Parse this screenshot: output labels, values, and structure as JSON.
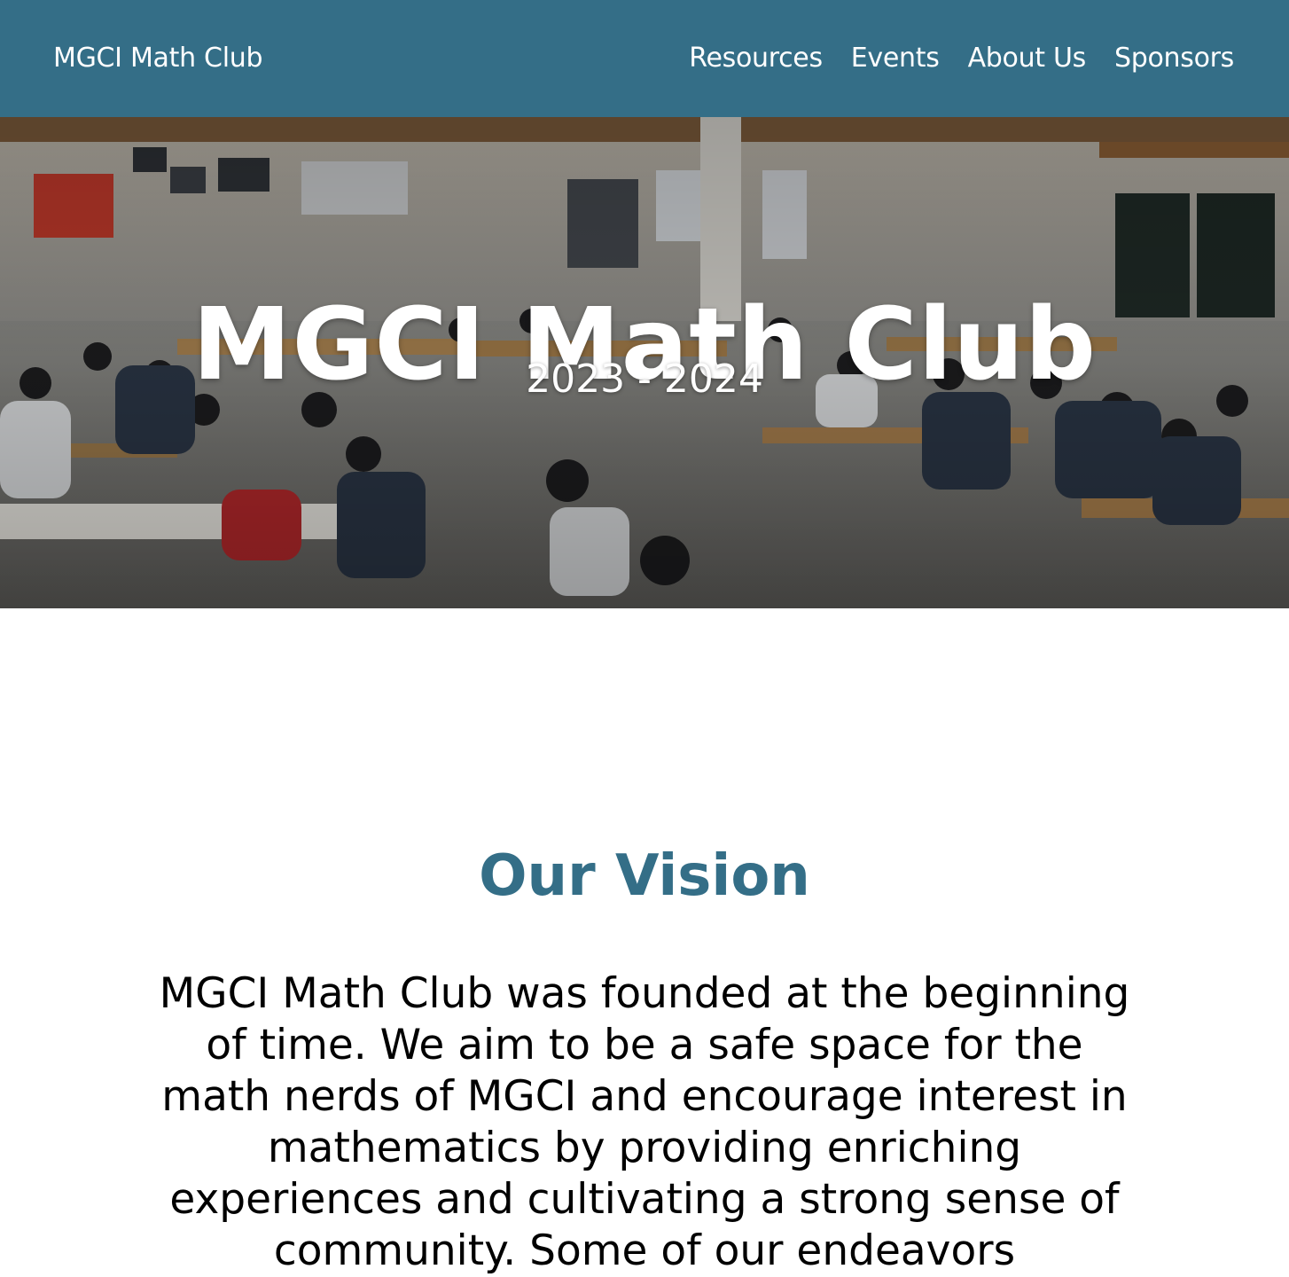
{
  "navbar": {
    "brand": "MGCI Math Club",
    "links": [
      {
        "label": "Resources"
      },
      {
        "label": "Events"
      },
      {
        "label": "About Us"
      },
      {
        "label": "Sponsors"
      }
    ],
    "background_color": "#346e87"
  },
  "hero": {
    "title": "MGCI Math Club",
    "subtitle": "2023 - 2024"
  },
  "vision": {
    "heading": "Our Vision",
    "text": "MGCI Math Club was founded at the beginning of time. We aim to be a safe space for the math nerds of MGCI and encourage interest in mathematics by providing enriching experiences and cultivating a strong sense of community. Some of our endeavors",
    "heading_color": "#346e87"
  }
}
